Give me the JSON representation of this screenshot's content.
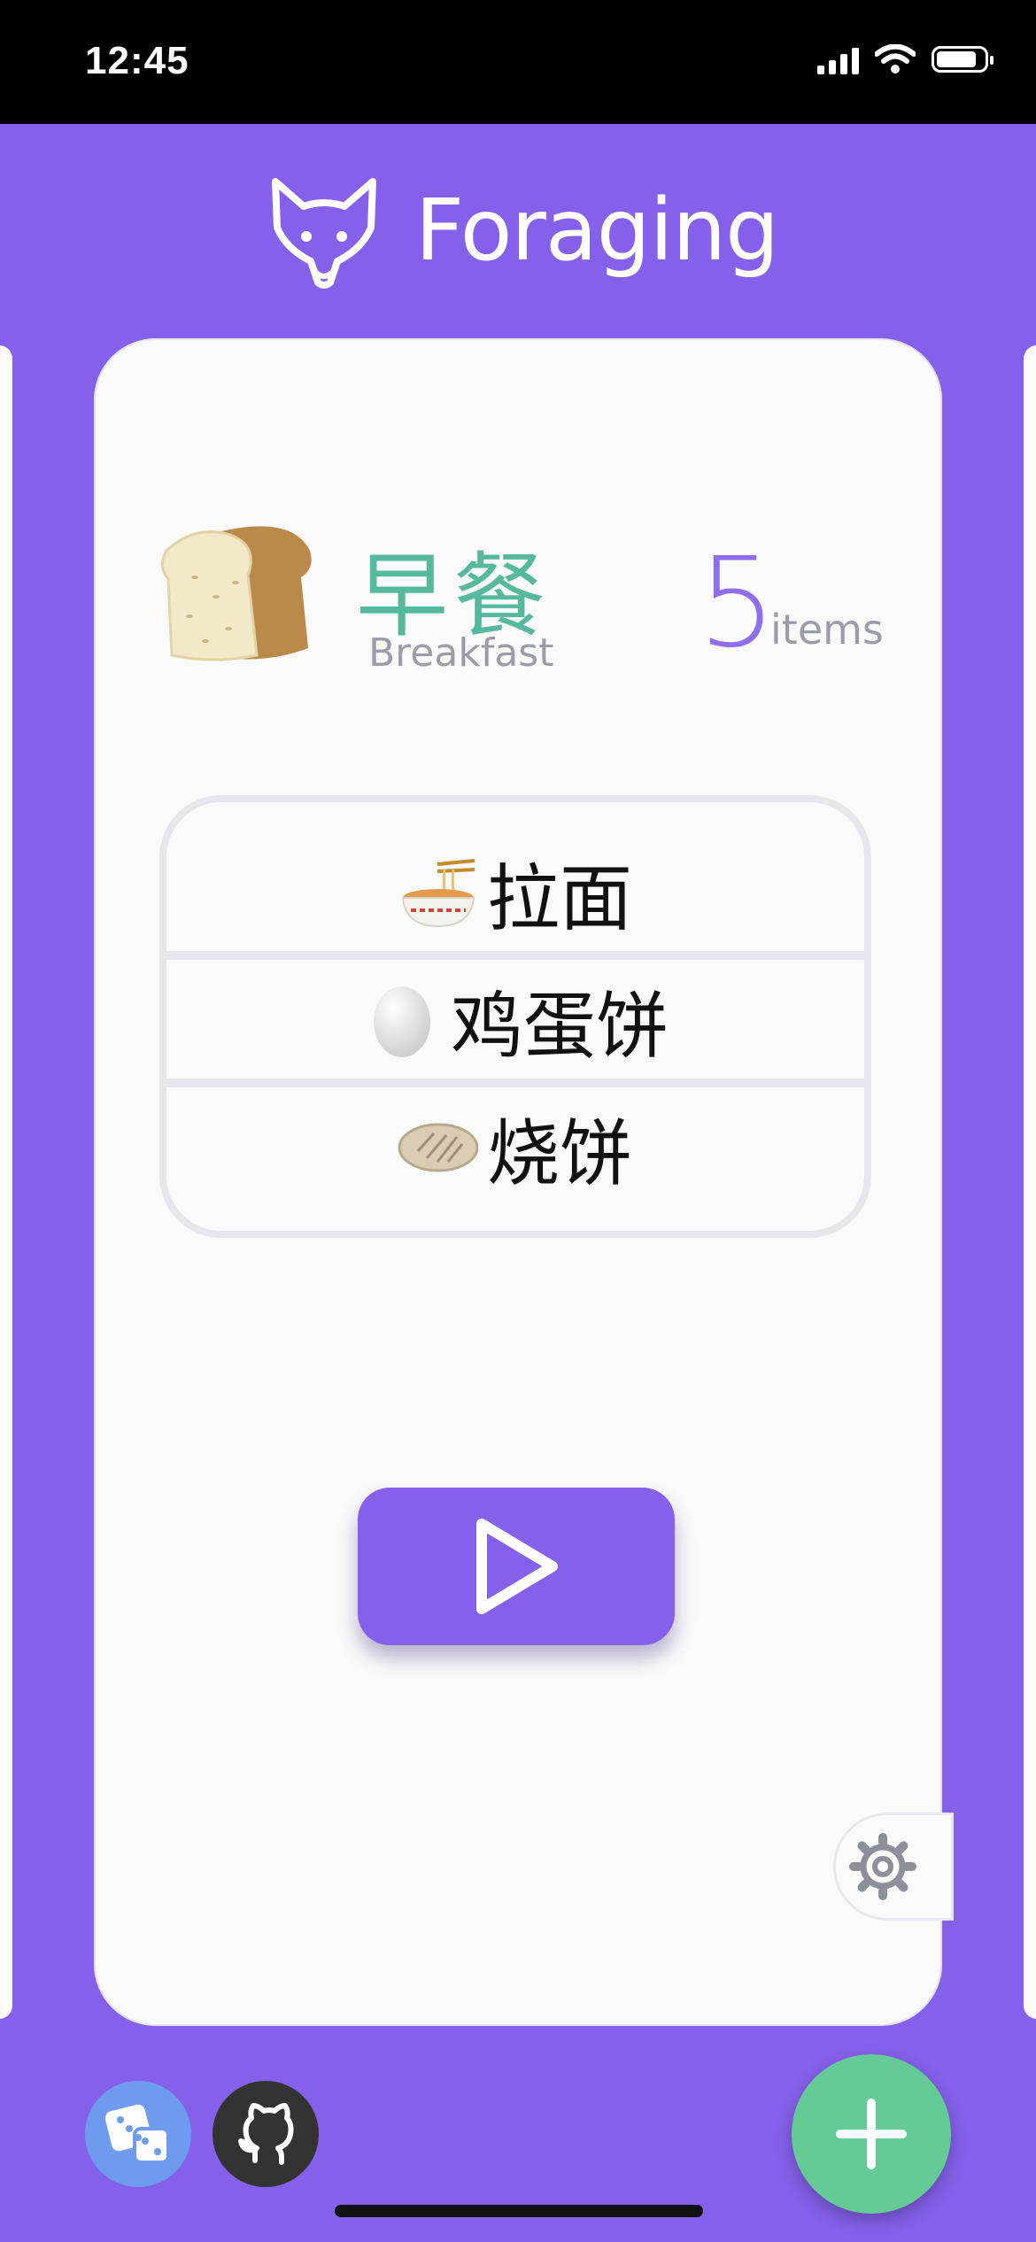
{
  "status_bar": {
    "time": "12:45"
  },
  "app": {
    "title": "Foraging"
  },
  "card": {
    "meal_name_zh": "早餐",
    "meal_name_en": "Breakfast",
    "item_count": "5",
    "item_count_label": "items",
    "items": [
      {
        "label": "拉面",
        "icon": "ramen-bowl-icon"
      },
      {
        "label": "鸡蛋饼",
        "icon": "egg-icon"
      },
      {
        "label": "烧饼",
        "icon": "flatbread-icon"
      }
    ]
  },
  "colors": {
    "background": "#8560EA",
    "card": "#FAFAFA",
    "meal_name": "#56B99D",
    "count": "#8F6EEC",
    "add_button": "#64CB97",
    "dice_button": "#6E9BEE",
    "github_button": "#333333"
  }
}
